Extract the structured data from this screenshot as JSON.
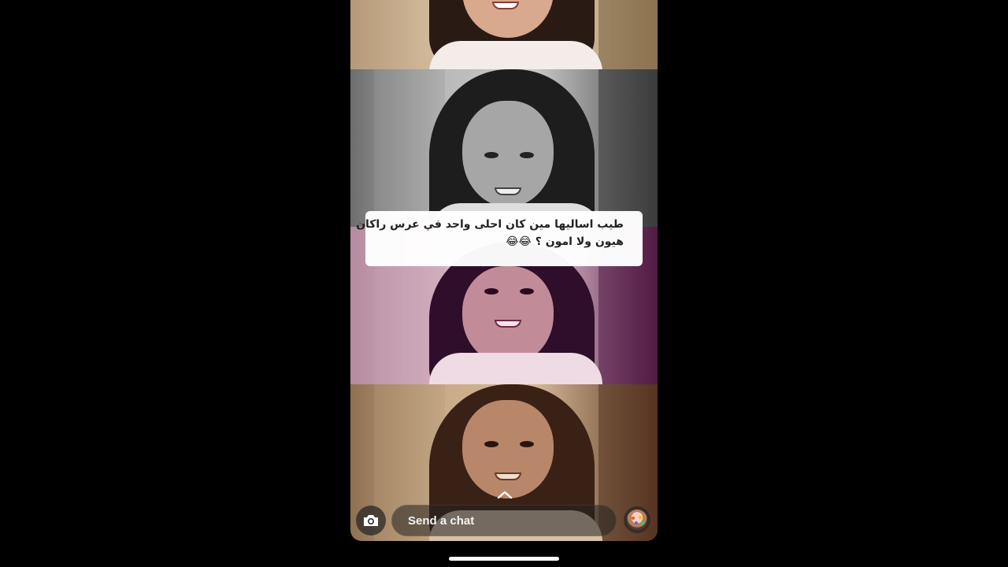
{
  "caption": {
    "line1": "طيب اساليها مين كان احلى واحد في عرس راكان",
    "line2": "هيون ولا امون ؟ 😂😂"
  },
  "chat_bar": {
    "camera_icon": "camera-icon",
    "placeholder": "Send a chat",
    "swipe_up_icon": "chevron-up-icon",
    "avatar_icon": "bitmoji-avatar"
  },
  "colors": {
    "background": "#000000",
    "caption_bg": "#ffffff",
    "chat_text": "#f2f2f2",
    "home_indicator": "#ffffff"
  }
}
